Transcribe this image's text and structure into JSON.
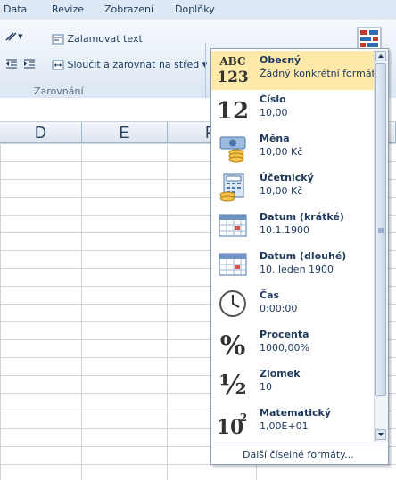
{
  "menu_tabs": [
    "Data",
    "Revize",
    "Zobrazení",
    "Doplňky"
  ],
  "ribbon": {
    "wrap_text": "Zalamovat text",
    "merge_center": "Sloučit a zarovnat na střed",
    "group_alignment": "Zarovnání",
    "number_format_value": ""
  },
  "columns": [
    "D",
    "E",
    "F"
  ],
  "number_formats": [
    {
      "name": "Obecný",
      "sample": "Žádný konkrétní formát",
      "icon": "abc-123-icon",
      "glyph": "ABC 123"
    },
    {
      "name": "Číslo",
      "sample": "10,00",
      "icon": "number-12-icon",
      "glyph": "12"
    },
    {
      "name": "Měna",
      "sample": "10,00 Kč",
      "icon": "currency-icon",
      "glyph": ""
    },
    {
      "name": "Účetnický",
      "sample": " 10,00 Kč",
      "icon": "accounting-icon",
      "glyph": ""
    },
    {
      "name": "Datum (krátké)",
      "sample": "10.1.1900",
      "icon": "calendar-short-icon",
      "glyph": ""
    },
    {
      "name": "Datum (dlouhé)",
      "sample": "10. leden 1900",
      "icon": "calendar-long-icon",
      "glyph": ""
    },
    {
      "name": "Čas",
      "sample": "0:00:00",
      "icon": "clock-icon",
      "glyph": ""
    },
    {
      "name": "Procenta",
      "sample": "1000,00%",
      "icon": "percent-icon",
      "glyph": "%"
    },
    {
      "name": "Zlomek",
      "sample": "10",
      "icon": "fraction-icon",
      "glyph": "½"
    },
    {
      "name": "Matematický",
      "sample": "1,00E+01",
      "icon": "scientific-icon",
      "glyph": "10²"
    }
  ],
  "more_formats": "Další číselné formáty...",
  "colors": {
    "selected": "#fde9a9",
    "ribbon_text": "#1e395b"
  }
}
